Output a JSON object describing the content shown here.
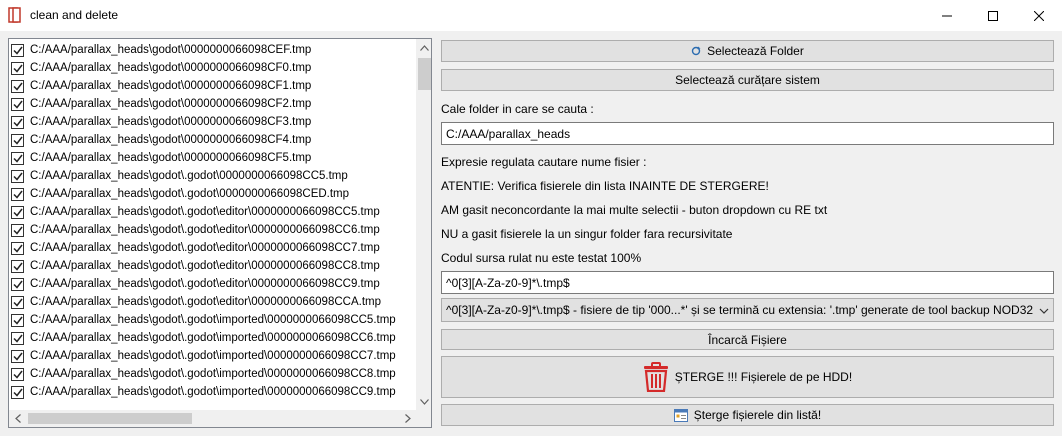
{
  "window": {
    "title": "clean and delete"
  },
  "file_list": {
    "items": [
      "C:/AAA/parallax_heads\\godot\\0000000066098CEF.tmp",
      "C:/AAA/parallax_heads\\godot\\0000000066098CF0.tmp",
      "C:/AAA/parallax_heads\\godot\\0000000066098CF1.tmp",
      "C:/AAA/parallax_heads\\godot\\0000000066098CF2.tmp",
      "C:/AAA/parallax_heads\\godot\\0000000066098CF3.tmp",
      "C:/AAA/parallax_heads\\godot\\0000000066098CF4.tmp",
      "C:/AAA/parallax_heads\\godot\\0000000066098CF5.tmp",
      "C:/AAA/parallax_heads\\godot\\.godot\\0000000066098CC5.tmp",
      "C:/AAA/parallax_heads\\godot\\.godot\\0000000066098CED.tmp",
      "C:/AAA/parallax_heads\\godot\\.godot\\editor\\0000000066098CC5.tmp",
      "C:/AAA/parallax_heads\\godot\\.godot\\editor\\0000000066098CC6.tmp",
      "C:/AAA/parallax_heads\\godot\\.godot\\editor\\0000000066098CC7.tmp",
      "C:/AAA/parallax_heads\\godot\\.godot\\editor\\0000000066098CC8.tmp",
      "C:/AAA/parallax_heads\\godot\\.godot\\editor\\0000000066098CC9.tmp",
      "C:/AAA/parallax_heads\\godot\\.godot\\editor\\0000000066098CCA.tmp",
      "C:/AAA/parallax_heads\\godot\\.godot\\imported\\0000000066098CC5.tmp",
      "C:/AAA/parallax_heads\\godot\\.godot\\imported\\0000000066098CC6.tmp",
      "C:/AAA/parallax_heads\\godot\\.godot\\imported\\0000000066098CC7.tmp",
      "C:/AAA/parallax_heads\\godot\\.godot\\imported\\0000000066098CC8.tmp",
      "C:/AAA/parallax_heads\\godot\\.godot\\imported\\0000000066098CC9.tmp"
    ]
  },
  "buttons": {
    "select_folder": "Selectează Folder",
    "select_system_clean": "Selectează curățare sistem",
    "load_files": "Încarcă Fișiere",
    "delete_hdd": "ȘTERGE !!! Fișierele de pe HDD!",
    "delete_from_list": "Șterge fișierele din listă!"
  },
  "labels": {
    "folder_path": "Cale folder in care se cauta :",
    "regex": "Expresie regulata cautare nume fisier :",
    "warning": "ATENTIE: Verifica fisierele din lista INAINTE DE STERGERE!",
    "note1": "AM gasit neconcordante la mai multe selectii - buton dropdown cu RE txt",
    "note2": "NU a gasit fisierele la un singur folder fara recursivitate",
    "note3": "Codul sursa rulat nu este testat 100%"
  },
  "inputs": {
    "folder_path_value": "C:/AAA/parallax_heads",
    "regex_value": "^0[3][A-Za-z0-9]*\\.tmp$"
  },
  "dropdown": {
    "selected": "^0[3][A-Za-z0-9]*\\.tmp$ - fisiere de tip '000...*' și se termină cu extensia: '.tmp' generate de tool backup NOD32"
  },
  "colors": {
    "trash_red": "#d42a2a",
    "window_bg": "#f0f0f0",
    "button_bg": "#e1e1e1"
  }
}
